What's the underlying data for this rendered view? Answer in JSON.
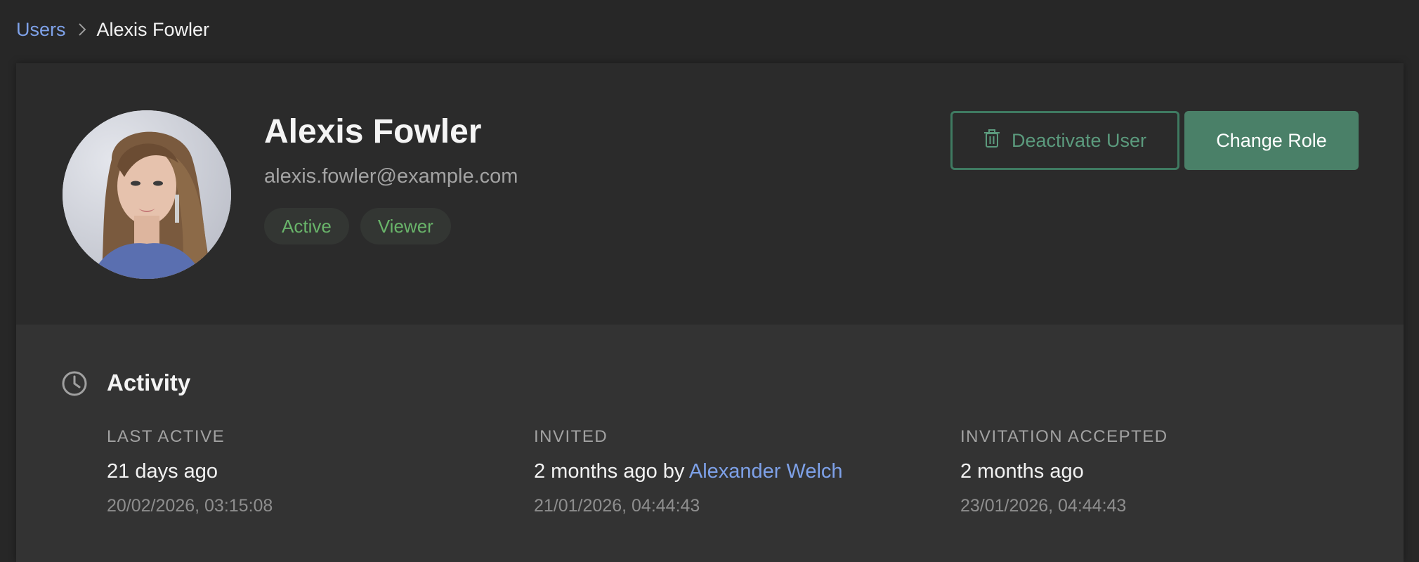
{
  "breadcrumb": {
    "parent": "Users",
    "current": "Alexis Fowler"
  },
  "user": {
    "name": "Alexis Fowler",
    "email": "alexis.fowler@example.com",
    "badges": [
      "Active",
      "Viewer"
    ]
  },
  "actions": {
    "deactivate_label": "Deactivate User",
    "change_role_label": "Change Role"
  },
  "activity": {
    "title": "Activity",
    "last_active": {
      "label": "LAST ACTIVE",
      "value": "21 days ago",
      "timestamp": "20/02/2026, 03:15:08"
    },
    "invited": {
      "label": "INVITED",
      "value_prefix": "2 months ago by ",
      "inviter": "Alexander Welch",
      "timestamp": "21/01/2026, 04:44:43"
    },
    "invitation_accepted": {
      "label": "INVITATION ACCEPTED",
      "value": "2 months ago",
      "timestamp": "23/01/2026, 04:44:43"
    }
  },
  "icons": {
    "breadcrumb_separator": "chevron-right-icon",
    "deactivate": "trash-icon",
    "activity": "clock-icon"
  },
  "colors": {
    "link": "#7ea1e8",
    "accent_green": "#4a8068",
    "badge_text": "#69b46a",
    "background": "#272727"
  }
}
